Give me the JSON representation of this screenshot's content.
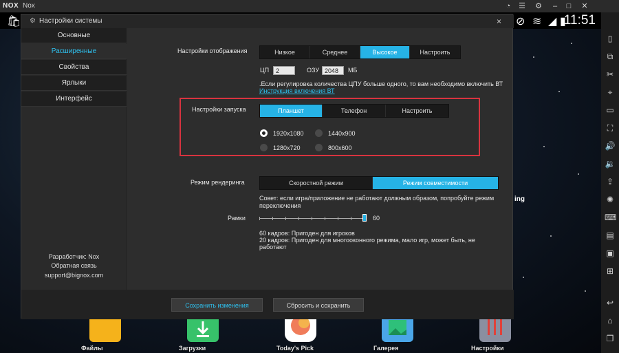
{
  "window": {
    "logo": "NOX",
    "title": "Nox"
  },
  "statusbar": {
    "time": "11:51"
  },
  "dialog": {
    "title": "Настройки системы",
    "close_symbol": "×",
    "nav": [
      {
        "label": "Основные"
      },
      {
        "label": "Расширенные"
      },
      {
        "label": "Свойства"
      },
      {
        "label": "Ярлыки"
      },
      {
        "label": "Интерфейс"
      }
    ],
    "developer": {
      "line1": "Разработчик: Nox",
      "line2": "Обратная связь",
      "line3": "support@bignox.com"
    },
    "display": {
      "label": "Настройки отображения",
      "options": [
        "Низкое",
        "Среднее",
        "Высокое",
        "Настроить"
      ],
      "selected": "Высокое",
      "cpu_label": "ЦП",
      "cpu_value": "2",
      "ram_label": "ОЗУ",
      "ram_value": "2048",
      "ram_unit": "МБ",
      "note": ".Если регулировка количества ЦПУ больше одного, то вам необходимо включить ВТ",
      "link": "Инструкция включения ВТ"
    },
    "startup": {
      "label": "Настройки запуска",
      "options": [
        "Планшет",
        "Телефон",
        "Настроить"
      ],
      "selected": "Планшет",
      "resolutions": [
        {
          "label": "1920x1080",
          "selected": true
        },
        {
          "label": "1440x900",
          "selected": false
        },
        {
          "label": "1280x720",
          "selected": false
        },
        {
          "label": "800x600",
          "selected": false
        }
      ]
    },
    "render": {
      "label": "Режим рендеринга",
      "options": [
        "Скоростной режим",
        "Режим совместимости"
      ],
      "selected": "Режим совместимости",
      "tip": "Совет: если игра/приложение не работают должным образом, попробуйте режим переключения"
    },
    "frames": {
      "label": "Рамки",
      "value": "60",
      "level_fraction": 1.0,
      "note1": "60 кадров: Пригоден для игроков",
      "note2": "20 кадров: Пригоден для многооконного режима, мало игр, может быть, не работают"
    },
    "footer": {
      "save": "Сохранить изменения",
      "reset": "Сбросить и сохранить"
    }
  },
  "dock": [
    {
      "label": "Файлы",
      "color": "#f5b21b"
    },
    {
      "label": "Загрузки",
      "color": "#37c26a"
    },
    {
      "label": "Today's Pick",
      "color": "#f07c5a"
    },
    {
      "label": "Галерея",
      "color": "#4aa6e8"
    },
    {
      "label": "Настройки",
      "color": "#8a8fa0"
    }
  ],
  "partial_label": "ing",
  "colors": {
    "accent": "#26b3e6",
    "highlight": "#d9333f"
  }
}
